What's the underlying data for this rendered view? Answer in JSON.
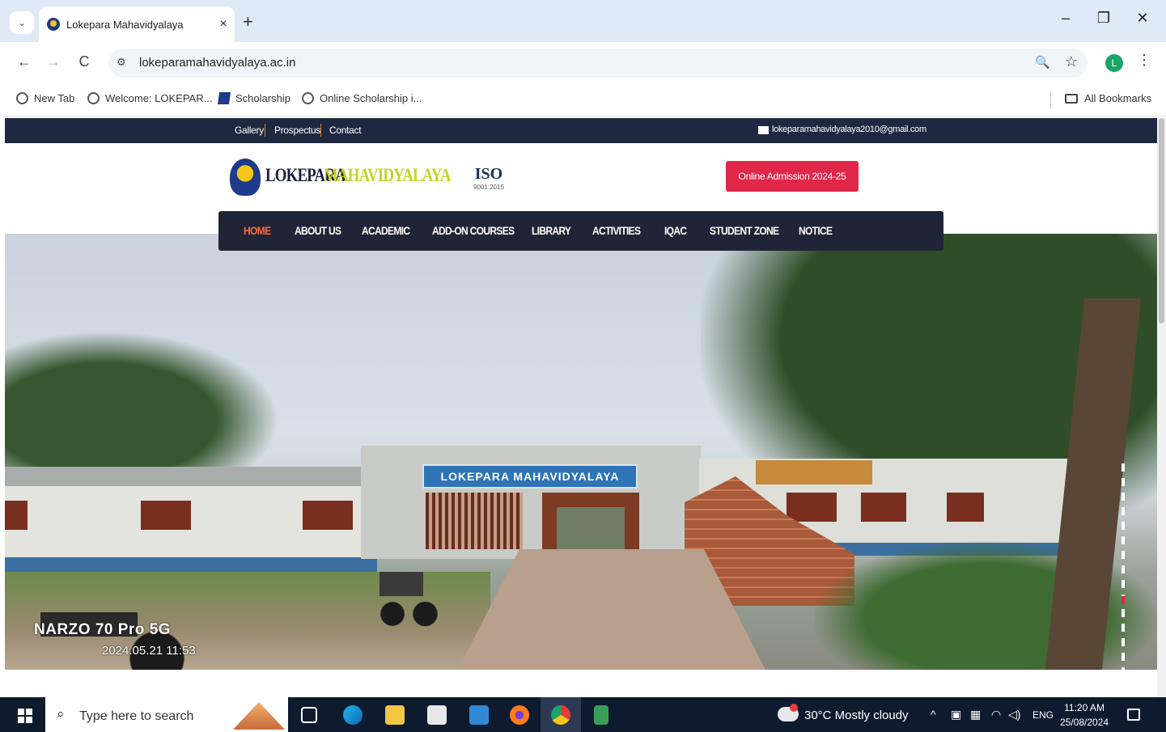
{
  "browser": {
    "tab_title": "Lokepara Mahavidyalaya",
    "tab_close": "×",
    "new_tab": "+",
    "tab_list": "⌄",
    "window_min": "–",
    "window_max": "❐",
    "window_close": "✕",
    "back": "←",
    "forward": "→",
    "reload": "C",
    "url": "lokeparamahavidyalaya.ac.in",
    "profile_initial": "L",
    "menu": "⋮",
    "zoom": "🔍",
    "star": "☆"
  },
  "bookmarks": {
    "items": [
      {
        "label": "New Tab",
        "icon": "globe-icon"
      },
      {
        "label": "Welcome: LOKEPAR...",
        "icon": "globe-icon"
      },
      {
        "label": "Scholarship",
        "icon": "scholarship-icon"
      },
      {
        "label": "Online Scholarship i...",
        "icon": "globe-icon"
      }
    ],
    "all_bookmarks": "All Bookmarks"
  },
  "site": {
    "topbar": {
      "links": [
        "Gallery",
        "Prospectus",
        "Contact"
      ],
      "email": "lokeparamahavidyalaya2010@gmail.com"
    },
    "logo": {
      "part1": "LOKEPARA",
      "part2": "MAHAVIDYALAYA"
    },
    "iso": {
      "title": "ISO",
      "sub": "9001:2015"
    },
    "admission_button": "Online Admission 2024-25",
    "nav": [
      "HOME",
      "ABOUT US",
      "ACADEMIC",
      "ADD-ON COURSES",
      "LIBRARY",
      "ACTIVITIES",
      "IQAC",
      "STUDENT ZONE",
      "NOTICE"
    ],
    "hero": {
      "gate_sign": "LOKEPARA MAHAVIDYALAYA",
      "watermark_device": "NARZO 70 Pro 5G",
      "watermark_time": "2024.05.21 11:53"
    },
    "colors": {
      "topbar": "#1e2841",
      "accent": "#e0274a",
      "nav_active": "#ff6b3a",
      "logo_green": "#c6d326"
    }
  },
  "taskbar": {
    "search_placeholder": "Type here to search",
    "weather": "30°C  Mostly cloudy",
    "language": "ENG",
    "time": "11:20 AM",
    "date": "25/08/2024"
  }
}
